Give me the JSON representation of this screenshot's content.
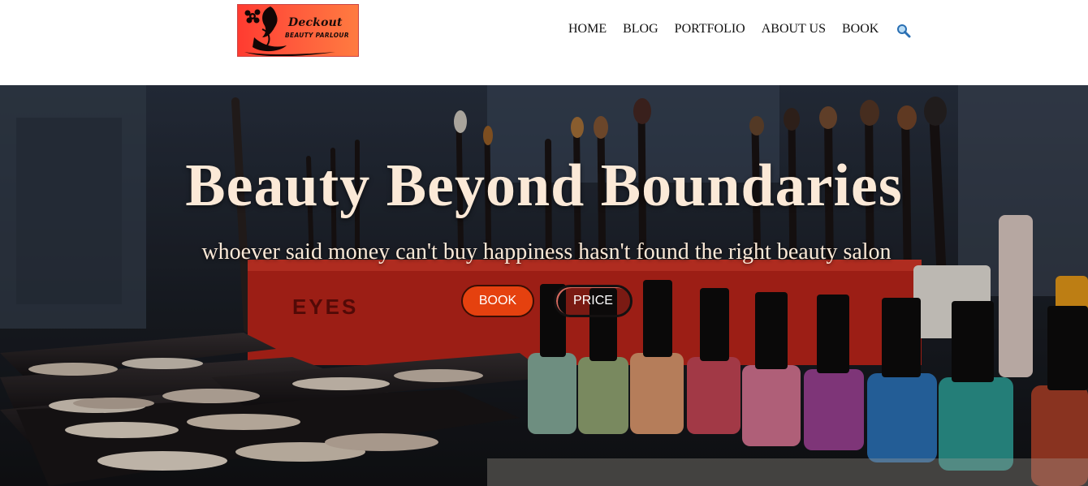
{
  "brand": {
    "name": "Deckout",
    "tagline": "BEAUTY PARLOUR",
    "logo_colors": [
      "#ff3b30",
      "#ff7b40"
    ]
  },
  "nav": {
    "items": [
      "HOME",
      "BLOG",
      "PORTFOLIO",
      "ABOUT US",
      "BOOK"
    ],
    "search_icon": "search-icon"
  },
  "hero": {
    "title": "Beauty Beyond Boundaries",
    "subtitle": "whoever said money can't buy happiness hasn't found the right beauty salon",
    "buttons": {
      "book": "BOOK",
      "price": "PRICE"
    },
    "background_label": "EYES",
    "accent_color": "#e5410f",
    "title_color": "#fbe9d7"
  }
}
